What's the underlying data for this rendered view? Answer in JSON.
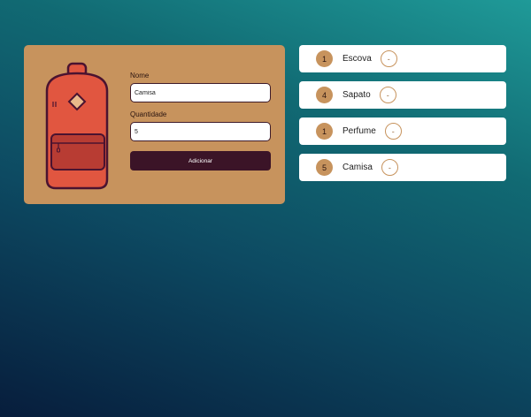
{
  "form": {
    "name_label": "Nome",
    "name_value": "Camisa",
    "quantity_label": "Quantidade",
    "quantity_value": "5",
    "submit_label": "Adicionar"
  },
  "items": [
    {
      "quantity": "1",
      "name": "Escova",
      "remove_label": "-"
    },
    {
      "quantity": "4",
      "name": "Sapato",
      "remove_label": "-"
    },
    {
      "quantity": "1",
      "name": "Perfume",
      "remove_label": "-"
    },
    {
      "quantity": "5",
      "name": "Camisa",
      "remove_label": "-"
    }
  ],
  "colors": {
    "card": "#c7935d",
    "accent": "#3b1427",
    "backpack": "#e15640",
    "backpack_outline": "#4a1330"
  },
  "icons": {
    "illustration": "backpack-icon"
  }
}
